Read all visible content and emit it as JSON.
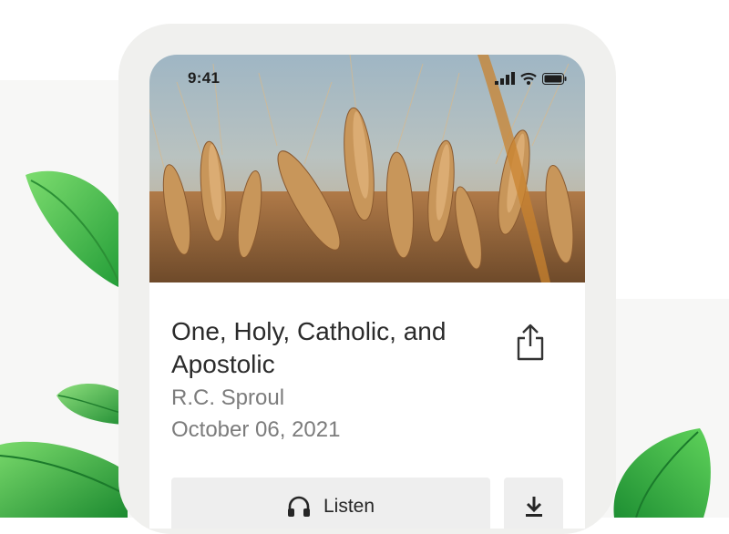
{
  "status_bar": {
    "time": "9:41",
    "icons": [
      "cellular-signal-icon",
      "wifi-icon",
      "battery-icon"
    ]
  },
  "hero": {
    "image": "wheat-field-photo"
  },
  "sermon": {
    "title": "One, Holy, Catholic, and Apostolic",
    "speaker": "R.C. Sproul",
    "date": "October 06, 2021"
  },
  "actions": {
    "share_icon": "share-icon",
    "listen_label": "Listen",
    "listen_icon": "headphones-icon",
    "download_icon": "download-icon"
  },
  "colors": {
    "frame": "#f0f0ee",
    "button_bg": "#eeeeee",
    "title_text": "#2b2b2b",
    "meta_text": "#7c7c7c",
    "leaf_green": "#34b244"
  }
}
